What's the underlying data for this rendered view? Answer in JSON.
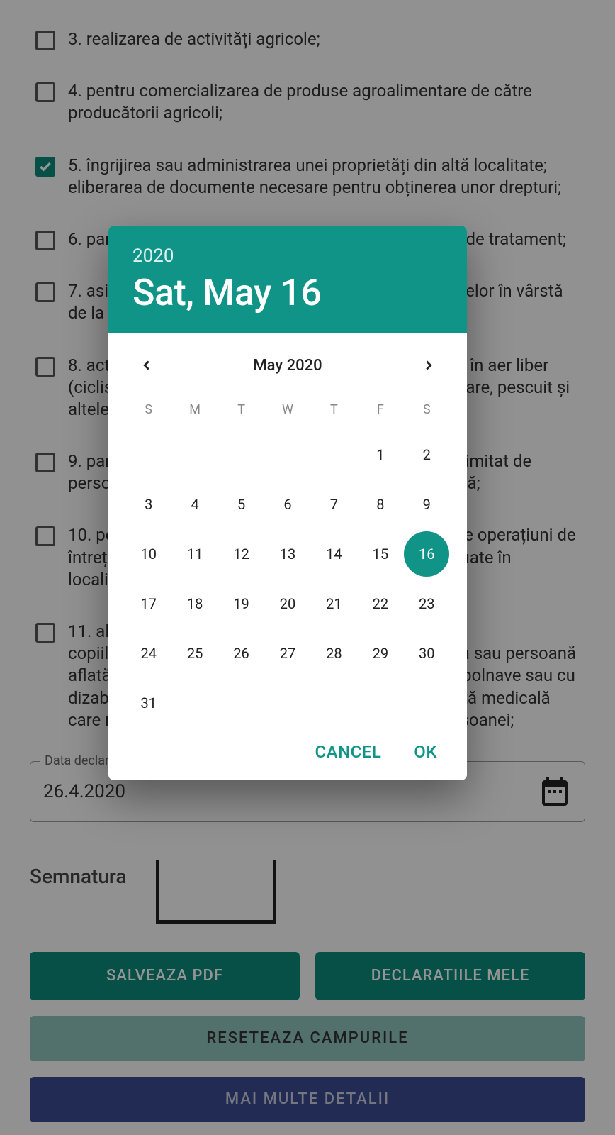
{
  "form": {
    "items": [
      {
        "text": "3. realizarea de activități agricole;",
        "checked": false
      },
      {
        "text": "4. pentru comercializarea de produse agroalimentare de către producătorii agricoli;",
        "checked": false
      },
      {
        "text": "5. îngrijirea sau administrarea unei proprietăți din altă localitate; eliberarea de documente necesare pentru obținerea unor drepturi;",
        "checked": true
      },
      {
        "text": "6. participarea la programe sau proceduri în centrele de tratament;",
        "checked": false
      },
      {
        "text": "7. asistența persoanelor cu dizabilități sau a persoanelor în vârstă de la distanță;",
        "checked": false
      },
      {
        "text": "8. activități recreativ-sportive individuale desfășurate în aer liber (ciclism, drumeție, alergare, canotaj, alpinism, vânătoare, pescuit și altele) cu participarea a cel mult 3 persoane;",
        "checked": false
      },
      {
        "text": "9. participarea la evenimente familiale, cu un număr limitat de persoane și respectarea regulilor de distanțare socială;",
        "checked": false
      },
      {
        "text": "10. pentru achiziția, service-ul, efectuarea ITP sau alte operațiuni de întreținere a vehiculelor, activități care nu pot fi efectuate în localitatea de domiciliu;",
        "checked": false
      },
      {
        "text": "11. alte motive justificate precum: îngrijirea/însoțirea copiilor/membrilor de familie; îngrijirea unei rude/afin sau persoană aflată în întreținere; asistență persoanelor vârstnice, bolnave sau cu dizabilități; deces al unui membru de familie; asistență medicală care nu poate fi amânată; activitățile de bază ale persoanei;",
        "checked": false
      }
    ],
    "date_label": "Data declaratiei",
    "date_value": "26.4.2020",
    "signature_label": "Semnatura",
    "buttons": {
      "save": "SALVEAZA PDF",
      "mine": "DECLARATIILE MELE",
      "reset": "RESETEAZA CAMPURILE",
      "more": "MAI MULTE DETALII"
    }
  },
  "datepicker": {
    "year": "2020",
    "header_date": "Sat, May 16",
    "month_label": "May 2020",
    "dow": [
      "S",
      "M",
      "T",
      "W",
      "T",
      "F",
      "S"
    ],
    "first_dow": 5,
    "days_in_month": 31,
    "selected": 16,
    "cancel": "CANCEL",
    "ok": "OK"
  }
}
